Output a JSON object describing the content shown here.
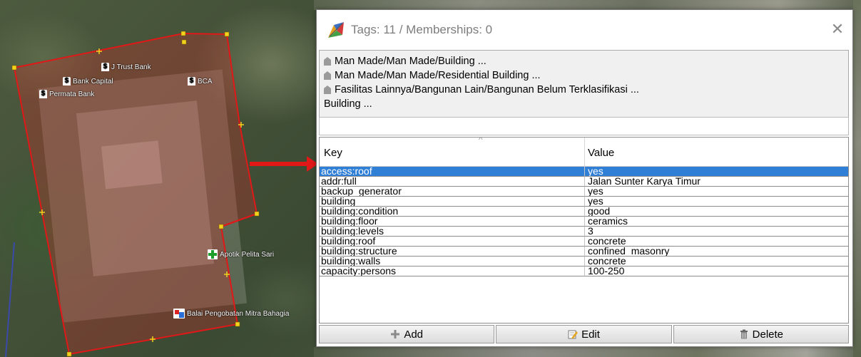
{
  "map": {
    "pois": [
      {
        "id": "jtrust",
        "label": "J Trust Bank",
        "icon": "bank-icon"
      },
      {
        "id": "bankcapital",
        "label": "Bank Capital",
        "icon": "bank-icon"
      },
      {
        "id": "bca",
        "label": "BCA",
        "icon": "bank-icon"
      },
      {
        "id": "permata",
        "label": "Permata Bank",
        "icon": "bank-icon"
      },
      {
        "id": "apotik",
        "label": "Apotik Pelita Sari",
        "icon": "pharmacy-icon"
      },
      {
        "id": "balai",
        "label": "Balai Pengobatan Mitra Bahagia",
        "icon": "clinic-icon"
      }
    ],
    "outline_color": "#e01818",
    "node_color": "#f2d21c"
  },
  "dialog": {
    "title": "Tags: 11 / Memberships: 0",
    "close_label": "✕",
    "presets": [
      {
        "label": "Man Made/Man Made/Building ...",
        "has_icon": true
      },
      {
        "label": "Man Made/Man Made/Residential Building ...",
        "has_icon": true
      },
      {
        "label": "Fasilitas Lainnya/Bangunan Lain/Bangunan Belum Terklasifikasi ...",
        "has_icon": true
      },
      {
        "label": "Building ...",
        "has_icon": false
      }
    ],
    "table": {
      "sort_indicator": "^",
      "headers": {
        "key": "Key",
        "value": "Value"
      },
      "rows": [
        {
          "key": "access:roof",
          "value": "yes",
          "selected": true
        },
        {
          "key": "addr:full",
          "value": "Jalan Sunter Karya Timur"
        },
        {
          "key": "backup_generator",
          "value": "yes"
        },
        {
          "key": "building",
          "value": "yes"
        },
        {
          "key": "building:condition",
          "value": "good"
        },
        {
          "key": "building:floor",
          "value": "ceramics"
        },
        {
          "key": "building:levels",
          "value": "3"
        },
        {
          "key": "building:roof",
          "value": "concrete"
        },
        {
          "key": "building:structure",
          "value": "confined_masonry"
        },
        {
          "key": "building:walls",
          "value": "concrete"
        },
        {
          "key": "capacity:persons",
          "value": "100-250"
        }
      ]
    },
    "buttons": {
      "add": "Add",
      "edit": "Edit",
      "delete": "Delete"
    },
    "colors": {
      "selection": "#2f7fd7"
    }
  }
}
